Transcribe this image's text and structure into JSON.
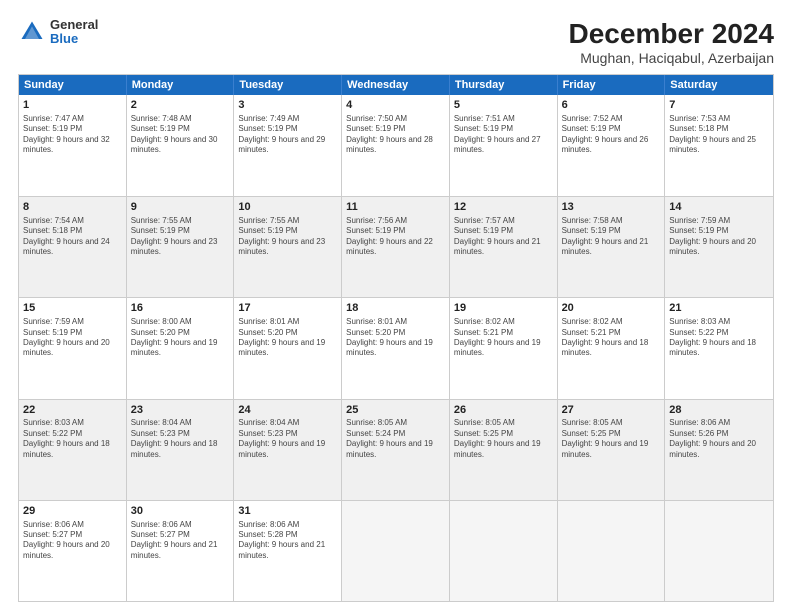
{
  "logo": {
    "general": "General",
    "blue": "Blue"
  },
  "header": {
    "title": "December 2024",
    "subtitle": "Mughan, Haciqabul, Azerbaijan"
  },
  "days_of_week": [
    "Sunday",
    "Monday",
    "Tuesday",
    "Wednesday",
    "Thursday",
    "Friday",
    "Saturday"
  ],
  "weeks": [
    [
      {
        "num": "1",
        "sunrise": "7:47 AM",
        "sunset": "5:19 PM",
        "daylight": "9 hours and 32 minutes"
      },
      {
        "num": "2",
        "sunrise": "7:48 AM",
        "sunset": "5:19 PM",
        "daylight": "9 hours and 30 minutes"
      },
      {
        "num": "3",
        "sunrise": "7:49 AM",
        "sunset": "5:19 PM",
        "daylight": "9 hours and 29 minutes"
      },
      {
        "num": "4",
        "sunrise": "7:50 AM",
        "sunset": "5:19 PM",
        "daylight": "9 hours and 28 minutes"
      },
      {
        "num": "5",
        "sunrise": "7:51 AM",
        "sunset": "5:19 PM",
        "daylight": "9 hours and 27 minutes"
      },
      {
        "num": "6",
        "sunrise": "7:52 AM",
        "sunset": "5:19 PM",
        "daylight": "9 hours and 26 minutes"
      },
      {
        "num": "7",
        "sunrise": "7:53 AM",
        "sunset": "5:18 PM",
        "daylight": "9 hours and 25 minutes"
      }
    ],
    [
      {
        "num": "8",
        "sunrise": "7:54 AM",
        "sunset": "5:18 PM",
        "daylight": "9 hours and 24 minutes"
      },
      {
        "num": "9",
        "sunrise": "7:55 AM",
        "sunset": "5:19 PM",
        "daylight": "9 hours and 23 minutes"
      },
      {
        "num": "10",
        "sunrise": "7:55 AM",
        "sunset": "5:19 PM",
        "daylight": "9 hours and 23 minutes"
      },
      {
        "num": "11",
        "sunrise": "7:56 AM",
        "sunset": "5:19 PM",
        "daylight": "9 hours and 22 minutes"
      },
      {
        "num": "12",
        "sunrise": "7:57 AM",
        "sunset": "5:19 PM",
        "daylight": "9 hours and 21 minutes"
      },
      {
        "num": "13",
        "sunrise": "7:58 AM",
        "sunset": "5:19 PM",
        "daylight": "9 hours and 21 minutes"
      },
      {
        "num": "14",
        "sunrise": "7:59 AM",
        "sunset": "5:19 PM",
        "daylight": "9 hours and 20 minutes"
      }
    ],
    [
      {
        "num": "15",
        "sunrise": "7:59 AM",
        "sunset": "5:19 PM",
        "daylight": "9 hours and 20 minutes"
      },
      {
        "num": "16",
        "sunrise": "8:00 AM",
        "sunset": "5:20 PM",
        "daylight": "9 hours and 19 minutes"
      },
      {
        "num": "17",
        "sunrise": "8:01 AM",
        "sunset": "5:20 PM",
        "daylight": "9 hours and 19 minutes"
      },
      {
        "num": "18",
        "sunrise": "8:01 AM",
        "sunset": "5:20 PM",
        "daylight": "9 hours and 19 minutes"
      },
      {
        "num": "19",
        "sunrise": "8:02 AM",
        "sunset": "5:21 PM",
        "daylight": "9 hours and 19 minutes"
      },
      {
        "num": "20",
        "sunrise": "8:02 AM",
        "sunset": "5:21 PM",
        "daylight": "9 hours and 18 minutes"
      },
      {
        "num": "21",
        "sunrise": "8:03 AM",
        "sunset": "5:22 PM",
        "daylight": "9 hours and 18 minutes"
      }
    ],
    [
      {
        "num": "22",
        "sunrise": "8:03 AM",
        "sunset": "5:22 PM",
        "daylight": "9 hours and 18 minutes"
      },
      {
        "num": "23",
        "sunrise": "8:04 AM",
        "sunset": "5:23 PM",
        "daylight": "9 hours and 18 minutes"
      },
      {
        "num": "24",
        "sunrise": "8:04 AM",
        "sunset": "5:23 PM",
        "daylight": "9 hours and 19 minutes"
      },
      {
        "num": "25",
        "sunrise": "8:05 AM",
        "sunset": "5:24 PM",
        "daylight": "9 hours and 19 minutes"
      },
      {
        "num": "26",
        "sunrise": "8:05 AM",
        "sunset": "5:25 PM",
        "daylight": "9 hours and 19 minutes"
      },
      {
        "num": "27",
        "sunrise": "8:05 AM",
        "sunset": "5:25 PM",
        "daylight": "9 hours and 19 minutes"
      },
      {
        "num": "28",
        "sunrise": "8:06 AM",
        "sunset": "5:26 PM",
        "daylight": "9 hours and 20 minutes"
      }
    ],
    [
      {
        "num": "29",
        "sunrise": "8:06 AM",
        "sunset": "5:27 PM",
        "daylight": "9 hours and 20 minutes"
      },
      {
        "num": "30",
        "sunrise": "8:06 AM",
        "sunset": "5:27 PM",
        "daylight": "9 hours and 21 minutes"
      },
      {
        "num": "31",
        "sunrise": "8:06 AM",
        "sunset": "5:28 PM",
        "daylight": "9 hours and 21 minutes"
      },
      null,
      null,
      null,
      null
    ]
  ]
}
